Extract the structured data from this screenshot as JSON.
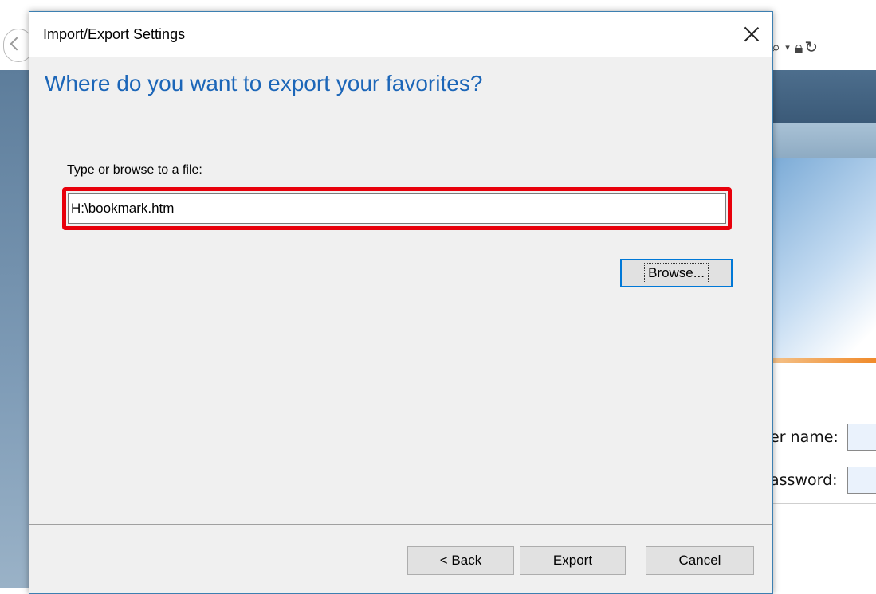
{
  "dialog": {
    "title": "Import/Export Settings",
    "heading": "Where do you want to export your favorites?",
    "field_label": "Type or browse to a file:",
    "file_path": "H:\\bookmark.htm",
    "buttons": {
      "browse": "Browse...",
      "back": "< Back",
      "export": "Export",
      "cancel": "Cancel"
    },
    "highlight_color": "#e8000b",
    "heading_color": "#1c66b8"
  },
  "background_page": {
    "username_label": "er name:",
    "password_label": "assword:",
    "toolbar_icons": [
      "search-icon",
      "dropdown-caret-icon",
      "lock-icon",
      "refresh-icon"
    ]
  }
}
